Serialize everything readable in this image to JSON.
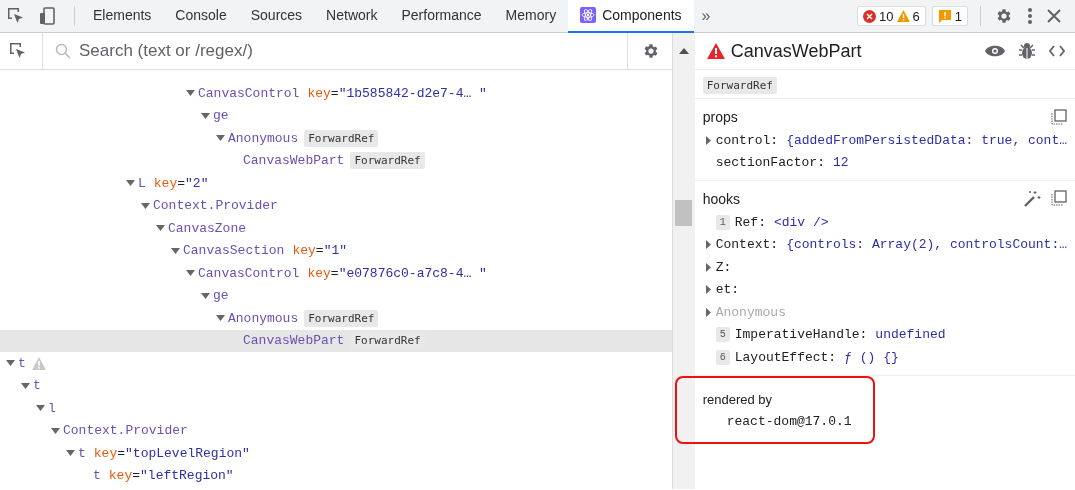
{
  "tabs": [
    {
      "label": "Elements",
      "selected": false
    },
    {
      "label": "Console",
      "selected": false
    },
    {
      "label": "Sources",
      "selected": false
    },
    {
      "label": "Network",
      "selected": false
    },
    {
      "label": "Performance",
      "selected": false
    },
    {
      "label": "Memory",
      "selected": false
    },
    {
      "label": "Components",
      "selected": true
    }
  ],
  "more_tabs": "»",
  "counters": {
    "errors": "10",
    "warnings": "6",
    "issues": "1"
  },
  "search": {
    "placeholder": "Search (text or /regex/)"
  },
  "tree": [
    {
      "children": [
        {
          "children": [
            {
              "children": [
                {
                  "children": [
                    {
                      "children": [
                        {
                          "children": [
                            {
                              "children": [
                                {
                                  "children": [
                                    {
                                      "children": [
                                        {
                                          "children": [
                                            {
                                              "children": [
                                                {
                                                  "children": [
                                                    {
                                                      "name": "CanvasControl",
                                                      "key": {
                                                        "name": "key",
                                                        "sep": "=",
                                                        "value": "\"1b585842-d2e7-4… \""
                                                      },
                                                      "selected": false,
                                                      "warning": false,
                                                      "children": [
                                                        {
                                                          "name": "ge",
                                                          "selected": false,
                                                          "warning": false,
                                                          "children": [
                                                            {
                                                              "name": "Anonymous",
                                                              "badge": "ForwardRef",
                                                              "selected": false,
                                                              "warning": false,
                                                              "children": [
                                                                {
                                                                  "name": "CanvasWebPart",
                                                                  "badge": "ForwardRef",
                                                                  "selected": false,
                                                                  "warning": false
                                                                }
                                                              ]
                                                            }
                                                          ]
                                                        }
                                                      ]
                                                    }
                                                  ]
                                                }
                                              ]
                                            }
                                          ]
                                        }
                                      ]
                                    },
                                    {
                                      "name": "L",
                                      "key": {
                                        "name": "key",
                                        "sep": "=",
                                        "value": "\"2\""
                                      },
                                      "selected": false,
                                      "warning": false,
                                      "children": [
                                        {
                                          "name": "Context.Provider",
                                          "selected": false,
                                          "warning": false,
                                          "children": [
                                            {
                                              "name": "CanvasZone",
                                              "selected": false,
                                              "warning": false,
                                              "children": [
                                                {
                                                  "name": "CanvasSection",
                                                  "key": {
                                                    "name": "key",
                                                    "sep": "=",
                                                    "value": "\"1\""
                                                  },
                                                  "selected": false,
                                                  "warning": false,
                                                  "children": [
                                                    {
                                                      "name": "CanvasControl",
                                                      "key": {
                                                        "name": "key",
                                                        "sep": "=",
                                                        "value": "\"e07876c0-a7c8-4… \""
                                                      },
                                                      "selected": false,
                                                      "warning": false,
                                                      "children": [
                                                        {
                                                          "name": "ge",
                                                          "selected": false,
                                                          "warning": false,
                                                          "children": [
                                                            {
                                                              "name": "Anonymous",
                                                              "badge": "ForwardRef",
                                                              "selected": false,
                                                              "warning": false,
                                                              "children": [
                                                                {
                                                                  "name": "CanvasWebPart",
                                                                  "badge": "ForwardRef",
                                                                  "selected": true,
                                                                  "warning": false
                                                                }
                                                              ]
                                                            }
                                                          ]
                                                        }
                                                      ]
                                                    }
                                                  ]
                                                }
                                              ]
                                            }
                                          ]
                                        }
                                      ]
                                    }
                                  ]
                                }
                              ]
                            }
                          ]
                        }
                      ]
                    }
                  ]
                }
              ]
            }
          ]
        }
      ]
    },
    {
      "name": "t",
      "selected": false,
      "warning": true,
      "children": [
        {
          "name": "t",
          "selected": false,
          "warning": false,
          "children": [
            {
              "name": "l",
              "selected": false,
              "warning": false,
              "children": [
                {
                  "name": "Context.Provider",
                  "selected": false,
                  "warning": false,
                  "children": [
                    {
                      "name": "t",
                      "key": {
                        "name": "key",
                        "sep": "=",
                        "value": "\"topLevelRegion\""
                      },
                      "selected": false,
                      "warning": false,
                      "children": [
                        {
                          "name": "t",
                          "key": {
                            "name": "key",
                            "sep": "=",
                            "value": "\"leftRegion\""
                          },
                          "selected": false,
                          "warning": false
                        }
                      ]
                    }
                  ]
                }
              ]
            }
          ]
        }
      ]
    }
  ],
  "inspector": {
    "title": "CanvasWebPart",
    "warning": true,
    "badge": "ForwardRef",
    "props": {
      "title": "props",
      "rows": [
        {
          "name": "control:",
          "value": "{addedFromPersistedData: true, cont…",
          "expandable": true
        },
        {
          "name": "sectionFactor:",
          "value": "12",
          "expandable": false
        }
      ]
    },
    "hooks": {
      "title": "hooks",
      "rows": [
        {
          "index": "1",
          "name": "Ref:",
          "value": "<div />",
          "expandable": false,
          "dimmed": false
        },
        {
          "name": "Context:",
          "value": "{controls: Array(2), controlsCount:…",
          "expandable": true,
          "dimmed": false
        },
        {
          "name": "Z:",
          "expandable": true,
          "dimmed": false
        },
        {
          "name": "et:",
          "expandable": true,
          "dimmed": false
        },
        {
          "name": "Anonymous",
          "expandable": true,
          "dimmed": true
        },
        {
          "index": "5",
          "name": "ImperativeHandle:",
          "value": "undefined",
          "expandable": false,
          "dimmed": false
        },
        {
          "index": "6",
          "name": "LayoutEffect:",
          "value": "ƒ () {}",
          "expandable": false,
          "dimmed": false
        }
      ]
    },
    "rendered_by": {
      "title": "rendered by",
      "value": "react-dom@17.0.1",
      "highlighted": true
    }
  }
}
